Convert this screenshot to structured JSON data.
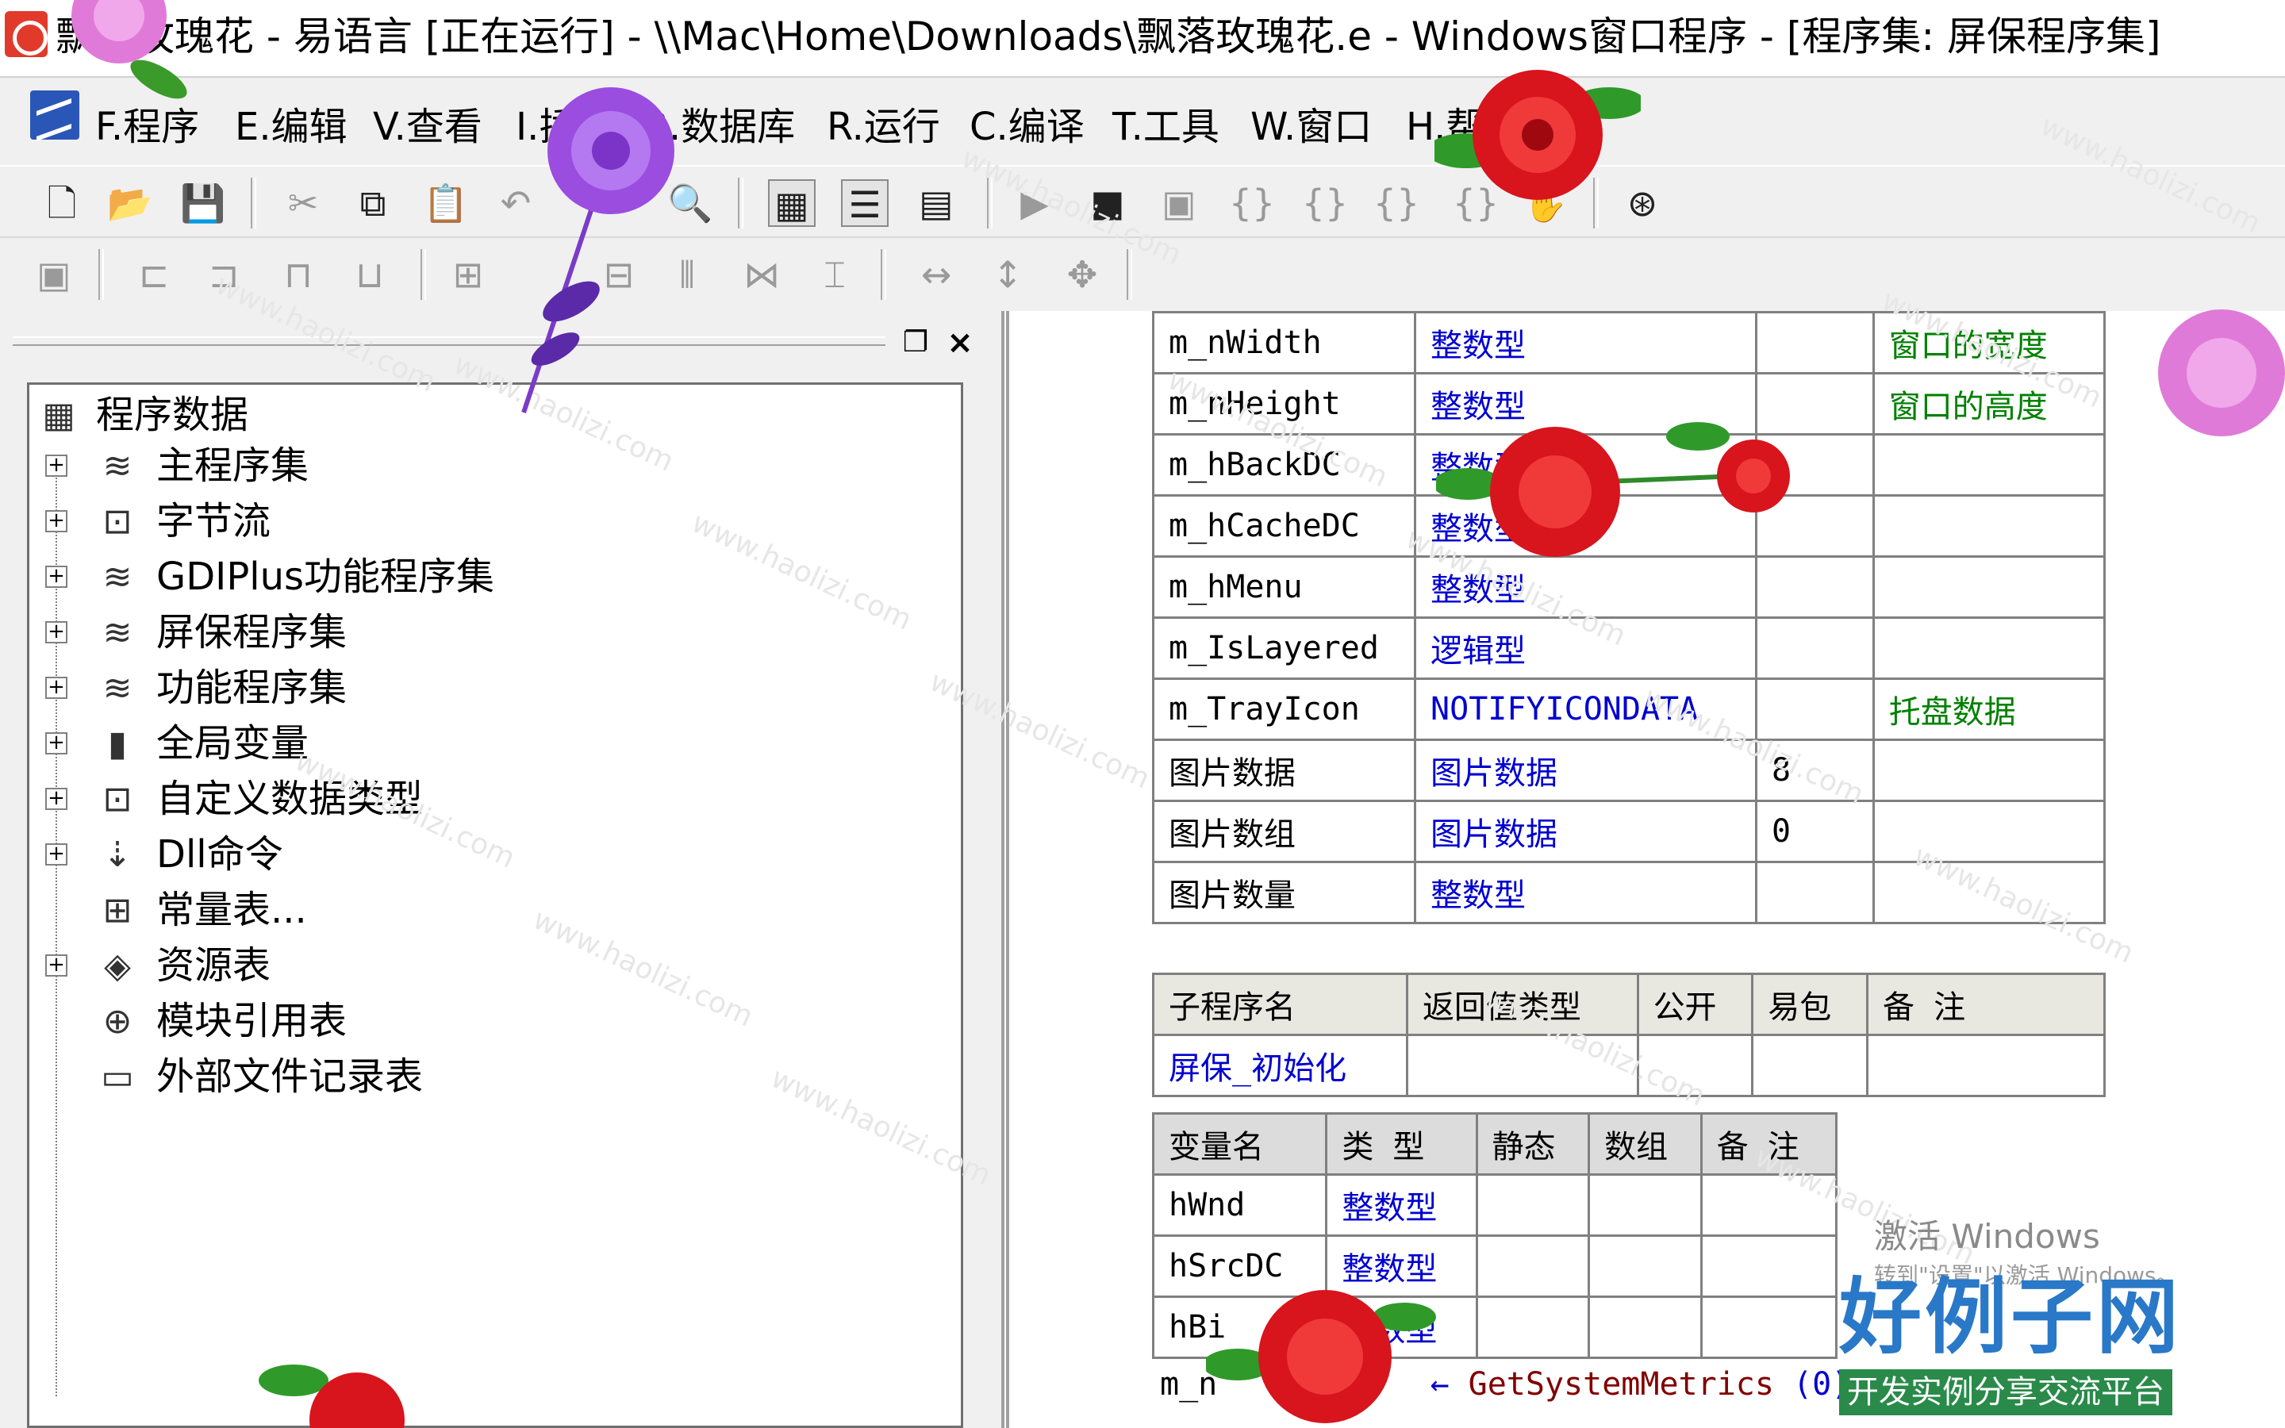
{
  "window": {
    "title": "飘落玫瑰花 - 易语言 [正在运行] - \\\\Mac\\Home\\Downloads\\飘落玫瑰花.e - Windows窗口程序 - [程序集: 屏保程序集]"
  },
  "menu": {
    "items": [
      "F.程序",
      "E.编辑",
      "V.查看",
      "I.插入",
      "B.数据库",
      "R.运行",
      "C.编译",
      "T.工具",
      "W.窗口",
      "H.帮助"
    ]
  },
  "toolbar1": {
    "buttons": [
      "new-file-icon",
      "open-folder-icon",
      "save-icon",
      "cut-icon",
      "copy-icon",
      "paste-icon",
      "undo-icon",
      "redo-icon",
      "find-icon",
      "layout-1-icon",
      "layout-2-icon",
      "layout-3-icon",
      "run-icon",
      "stop-icon",
      "debug-icon",
      "step-into-icon",
      "step-over-icon",
      "step-out-icon",
      "breakpoint-icon",
      "hand-icon",
      "binoculars-icon"
    ]
  },
  "toolbar2": {
    "buttons": [
      "align-grid-icon",
      "align-left-icon",
      "align-center-h-icon",
      "align-right-icon",
      "align-top-icon",
      "align-middle-icon",
      "align-bottom-icon",
      "distribute-h-icon",
      "distribute-v-icon",
      "same-width-icon",
      "same-height-icon",
      "same-size-icon"
    ]
  },
  "tree": {
    "root": "程序数据",
    "items": [
      {
        "label": "主程序集",
        "icon": "module-icon",
        "expandable": true
      },
      {
        "label": "字节流",
        "icon": "class-icon",
        "expandable": true
      },
      {
        "label": "GDIPlus功能程序集",
        "icon": "module-icon",
        "expandable": true
      },
      {
        "label": "屏保程序集",
        "icon": "module-icon",
        "expandable": true
      },
      {
        "label": "功能程序集",
        "icon": "module-icon",
        "expandable": true
      },
      {
        "label": "全局变量",
        "icon": "database-icon",
        "expandable": true
      },
      {
        "label": "自定义数据类型",
        "icon": "class-icon",
        "expandable": true
      },
      {
        "label": "Dll命令",
        "icon": "dll-icon",
        "expandable": true
      },
      {
        "label": "常量表...",
        "icon": "constant-icon",
        "expandable": false
      },
      {
        "label": "资源表",
        "icon": "resource-icon",
        "expandable": true
      },
      {
        "label": "模块引用表",
        "icon": "module-ref-icon",
        "expandable": false
      },
      {
        "label": "外部文件记录表",
        "icon": "file-icon",
        "expandable": false
      }
    ]
  },
  "assembly_vars": {
    "rows": [
      {
        "name": "m_nWidth",
        "type": "整数型",
        "array": "",
        "note": "窗口的宽度"
      },
      {
        "name": "m_nHeight",
        "type": "整数型",
        "array": "",
        "note": "窗口的高度"
      },
      {
        "name": "m_hBackDC",
        "type": "整数型",
        "array": "",
        "note": ""
      },
      {
        "name": "m_hCacheDC",
        "type": "整数型",
        "array": "",
        "note": ""
      },
      {
        "name": "m_hMenu",
        "type": "整数型",
        "array": "",
        "note": ""
      },
      {
        "name": "m_IsLayered",
        "type": "逻辑型",
        "array": "",
        "note": ""
      },
      {
        "name": "m_TrayIcon",
        "type": "NOTIFYICONDATA",
        "array": "",
        "note": "托盘数据"
      },
      {
        "name": "图片数据",
        "type": "图片数据",
        "array": "8",
        "note": ""
      },
      {
        "name": "图片数组",
        "type": "图片数据",
        "array": "0",
        "note": ""
      },
      {
        "name": "图片数量",
        "type": "整数型",
        "array": "",
        "note": ""
      }
    ]
  },
  "subroutine": {
    "headers": [
      "子程序名",
      "返回值类型",
      "公开",
      "易包",
      "备 注"
    ],
    "row": {
      "name": "屏保_初始化",
      "return_type": "",
      "public": "",
      "easy_pkg": "",
      "note": ""
    }
  },
  "local_vars": {
    "headers": [
      "变量名",
      "类 型",
      "静态",
      "数组",
      "备 注"
    ],
    "rows": [
      {
        "name": "hWnd",
        "type": "整数型"
      },
      {
        "name": "hSrcDC",
        "type": "整数型"
      },
      {
        "name": "hBi",
        "type": "整数型"
      }
    ]
  },
  "code": {
    "line_prefix": "m_n",
    "line_call": "GetSystemMetrics",
    "line_arg": "(0)"
  },
  "overlay": {
    "activate_title": "激活 Windows",
    "activate_sub": "转到\"设置\"以激活 Windows。",
    "site_logo": "好例子网",
    "site_slogan": "开发实例分享交流平台",
    "watermark": "www.haolizi.com"
  },
  "colors": {
    "type_blue": "#0000d0",
    "note_green": "#008000",
    "header_bg": "#e8e8e0",
    "rose_red": "#d8141c",
    "rose_purple": "#9b4de0"
  }
}
